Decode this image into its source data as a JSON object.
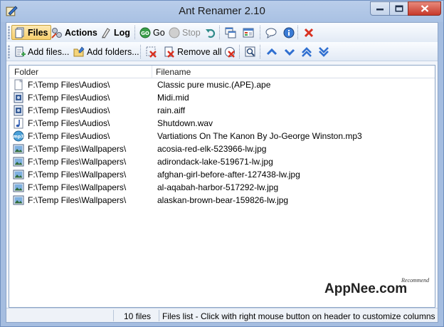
{
  "window": {
    "title": "Ant Renamer 2.10"
  },
  "toolbar1": {
    "files_label": "Files",
    "actions_label": "Actions",
    "log_label": "Log",
    "go_label": "Go",
    "stop_label": "Stop"
  },
  "toolbar2": {
    "add_files_label": "Add files...",
    "add_folders_label": "Add folders...",
    "remove_all_label": "Remove all"
  },
  "list": {
    "columns": {
      "folder": "Folder",
      "filename": "Filename"
    },
    "rows": [
      {
        "folder": "F:\\Temp Files\\Audios\\",
        "filename": "Classic pure music.(APE).ape",
        "icon": "blank-file-icon"
      },
      {
        "folder": "F:\\Temp Files\\Audios\\",
        "filename": "Midi.mid",
        "icon": "audio-file-icon"
      },
      {
        "folder": "F:\\Temp Files\\Audios\\",
        "filename": "rain.aiff",
        "icon": "audio-file-icon"
      },
      {
        "folder": "F:\\Temp Files\\Audios\\",
        "filename": "Shutdown.wav",
        "icon": "music-note-file-icon"
      },
      {
        "folder": "F:\\Temp Files\\Audios\\",
        "filename": "Vartiations On The Kanon By Jo-George Winston.mp3",
        "icon": "mp3-file-icon"
      },
      {
        "folder": "F:\\Temp Files\\Wallpapers\\",
        "filename": "acosia-red-elk-523966-lw.jpg",
        "icon": "image-file-icon"
      },
      {
        "folder": "F:\\Temp Files\\Wallpapers\\",
        "filename": "adirondack-lake-519671-lw.jpg",
        "icon": "image-file-icon"
      },
      {
        "folder": "F:\\Temp Files\\Wallpapers\\",
        "filename": "afghan-girl-before-after-127438-lw.jpg",
        "icon": "image-file-icon"
      },
      {
        "folder": "F:\\Temp Files\\Wallpapers\\",
        "filename": "al-aqabah-harbor-517292-lw.jpg",
        "icon": "image-file-icon"
      },
      {
        "folder": "F:\\Temp Files\\Wallpapers\\",
        "filename": "alaskan-brown-bear-159826-lw.jpg",
        "icon": "image-file-icon"
      }
    ]
  },
  "status": {
    "count": "10 files",
    "message": "Files list - Click with right mouse button on header to customize columns"
  },
  "watermark": {
    "brand": "AppNee.com",
    "tag": "Recommend"
  },
  "colors": {
    "title_bar": "#b3c8e8",
    "close_button": "#c7392b",
    "toolbar_active": "#f7cf6d",
    "nav_arrows": "#2f6fd0"
  }
}
